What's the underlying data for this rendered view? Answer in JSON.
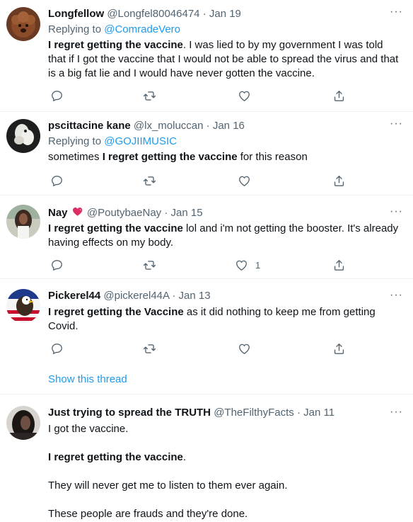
{
  "tweets": [
    {
      "name": "Longfellow",
      "handle": "@Longfel80046474",
      "sep": "·",
      "date": "Jan 19",
      "replying_label": "Replying to",
      "replying_handle": "@ComradeVero",
      "text_bold": "I regret getting the vaccine",
      "text_rest": ". I was lied to by my government I was told that if I got the vaccine that I would not be able to spread the virus and that is a big fat lie and I would have never gotten the vaccine.",
      "like_count": "",
      "more": "···"
    },
    {
      "name": "pscittacine kane",
      "handle": "@lx_moluccan",
      "sep": "·",
      "date": "Jan 16",
      "replying_label": "Replying to",
      "replying_handle": "@GOJIIMUSIC",
      "text_pre": "sometimes ",
      "text_bold": "I regret getting the vaccine",
      "text_rest": " for this reason",
      "like_count": "",
      "more": "···"
    },
    {
      "name": "Nay",
      "handle": "@PoutybaeNay",
      "sep": "·",
      "date": "Jan 15",
      "text_bold": "I regret getting the vaccine",
      "text_rest": " lol and i'm not getting the booster. It's already having effects on my body.",
      "like_count": "1",
      "more": "···"
    },
    {
      "name": "Pickerel44",
      "handle": "@pickerel44A",
      "sep": "·",
      "date": "Jan 13",
      "text_bold": "I regret getting the Vaccine",
      "text_rest": " as it did nothing to keep me from getting Covid.",
      "like_count": "",
      "show_thread": "Show this thread",
      "more": "···"
    },
    {
      "name": "Just trying to spread the TRUTH",
      "handle": "@TheFilthyFacts",
      "sep": "·",
      "date": "Jan 11",
      "line1": "I got the vaccine.",
      "line2_bold": "I regret getting the vaccine",
      "line2_rest": ".",
      "line3": "They will never get me to listen to them ever again.",
      "line4": "These people are frauds and they're done.",
      "more": "···"
    }
  ],
  "icons": {
    "reply": "reply-icon",
    "retweet": "retweet-icon",
    "like": "heart-icon",
    "share": "share-icon",
    "more": "more-icon"
  },
  "colors": {
    "link": "#1d9bf0",
    "secondary_text": "#536471",
    "primary_text": "#0f1419",
    "divider": "#eff3f4"
  }
}
